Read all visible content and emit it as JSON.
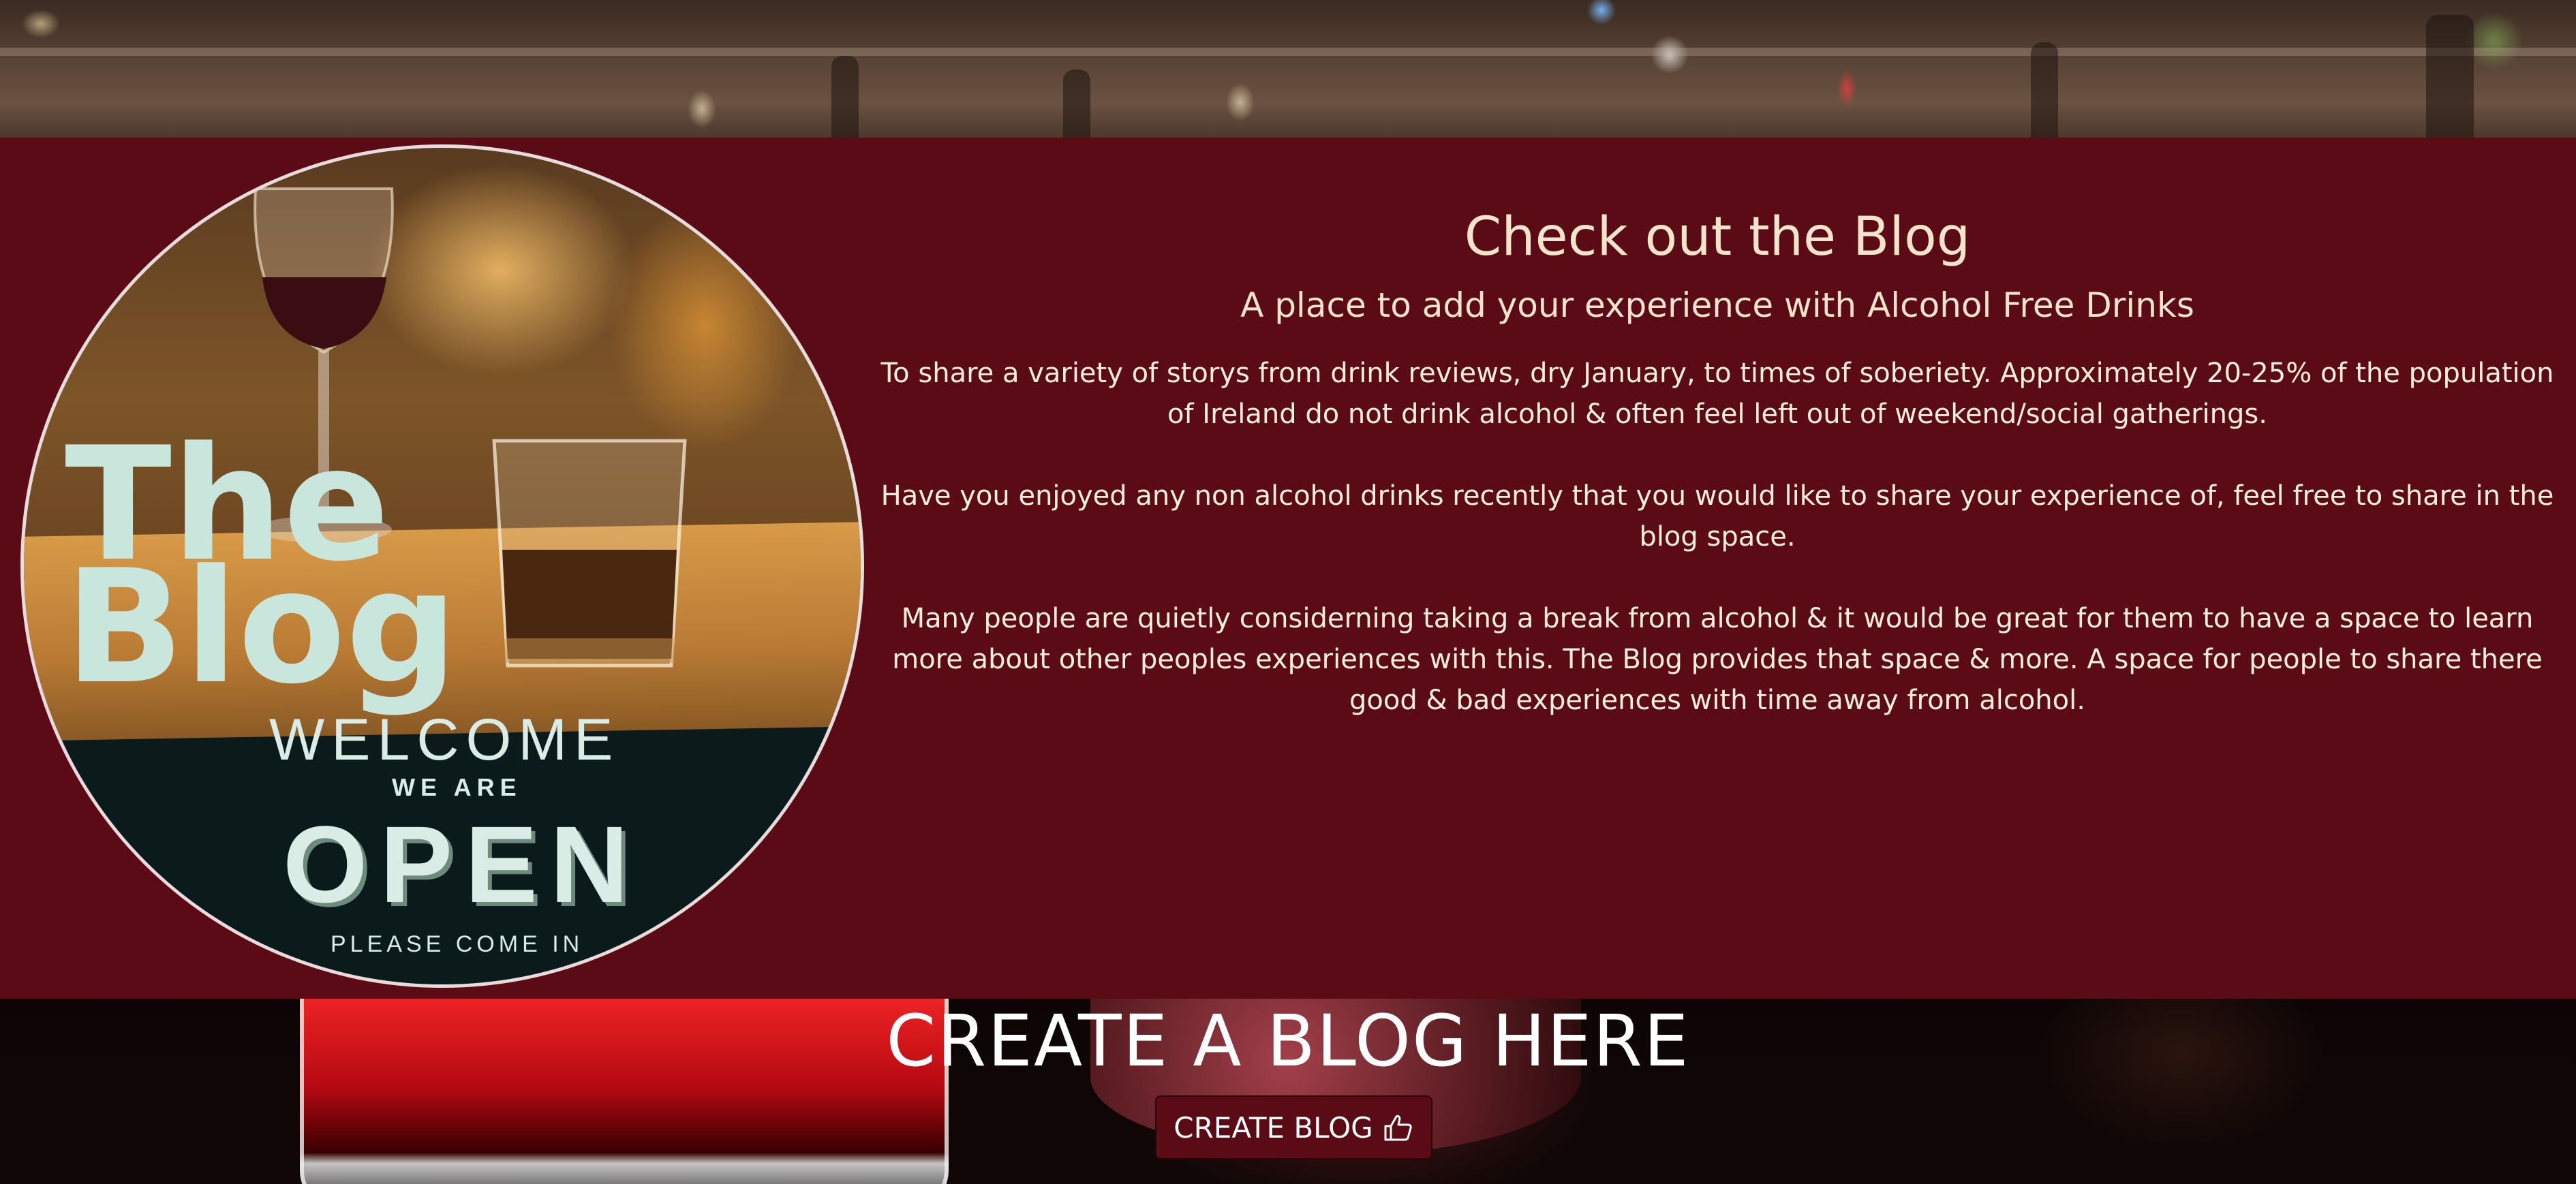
{
  "blog": {
    "image_alt_text": {
      "line1": "The",
      "line2": "Blog",
      "welcome": "WELCOME",
      "we_are": "WE ARE",
      "open": "OPEN",
      "come_in": "PLEASE COME IN"
    },
    "title": "Check out the Blog",
    "subtitle": "A place to add your experience with Alcohol Free Drinks",
    "paragraphs": [
      "To share a variety of storys from drink reviews, dry January, to times of soberiety. Approximately 20-25% of the population of Ireland do not drink alcohol & often feel left out of weekend/social gatherings.",
      "Have you enjoyed any non alcohol drinks recently that you would like to share your experience of, feel free to share in the blog space.",
      "Many people are quietly considerning taking a break from alcohol & it would be great for them to have a space to learn more about other peoples experiences with this. The Blog provides that space & more. A space for people to share there good & bad experiences with time away from alcohol."
    ]
  },
  "cta": {
    "title": "CREATE A BLOG HERE",
    "button_label": "CREATE BLOG",
    "button_icon": "thumbs-up-icon"
  },
  "colors": {
    "section_bg": "#5a0b16",
    "heading": "#f5e4cc",
    "body_text": "#fbeede"
  }
}
